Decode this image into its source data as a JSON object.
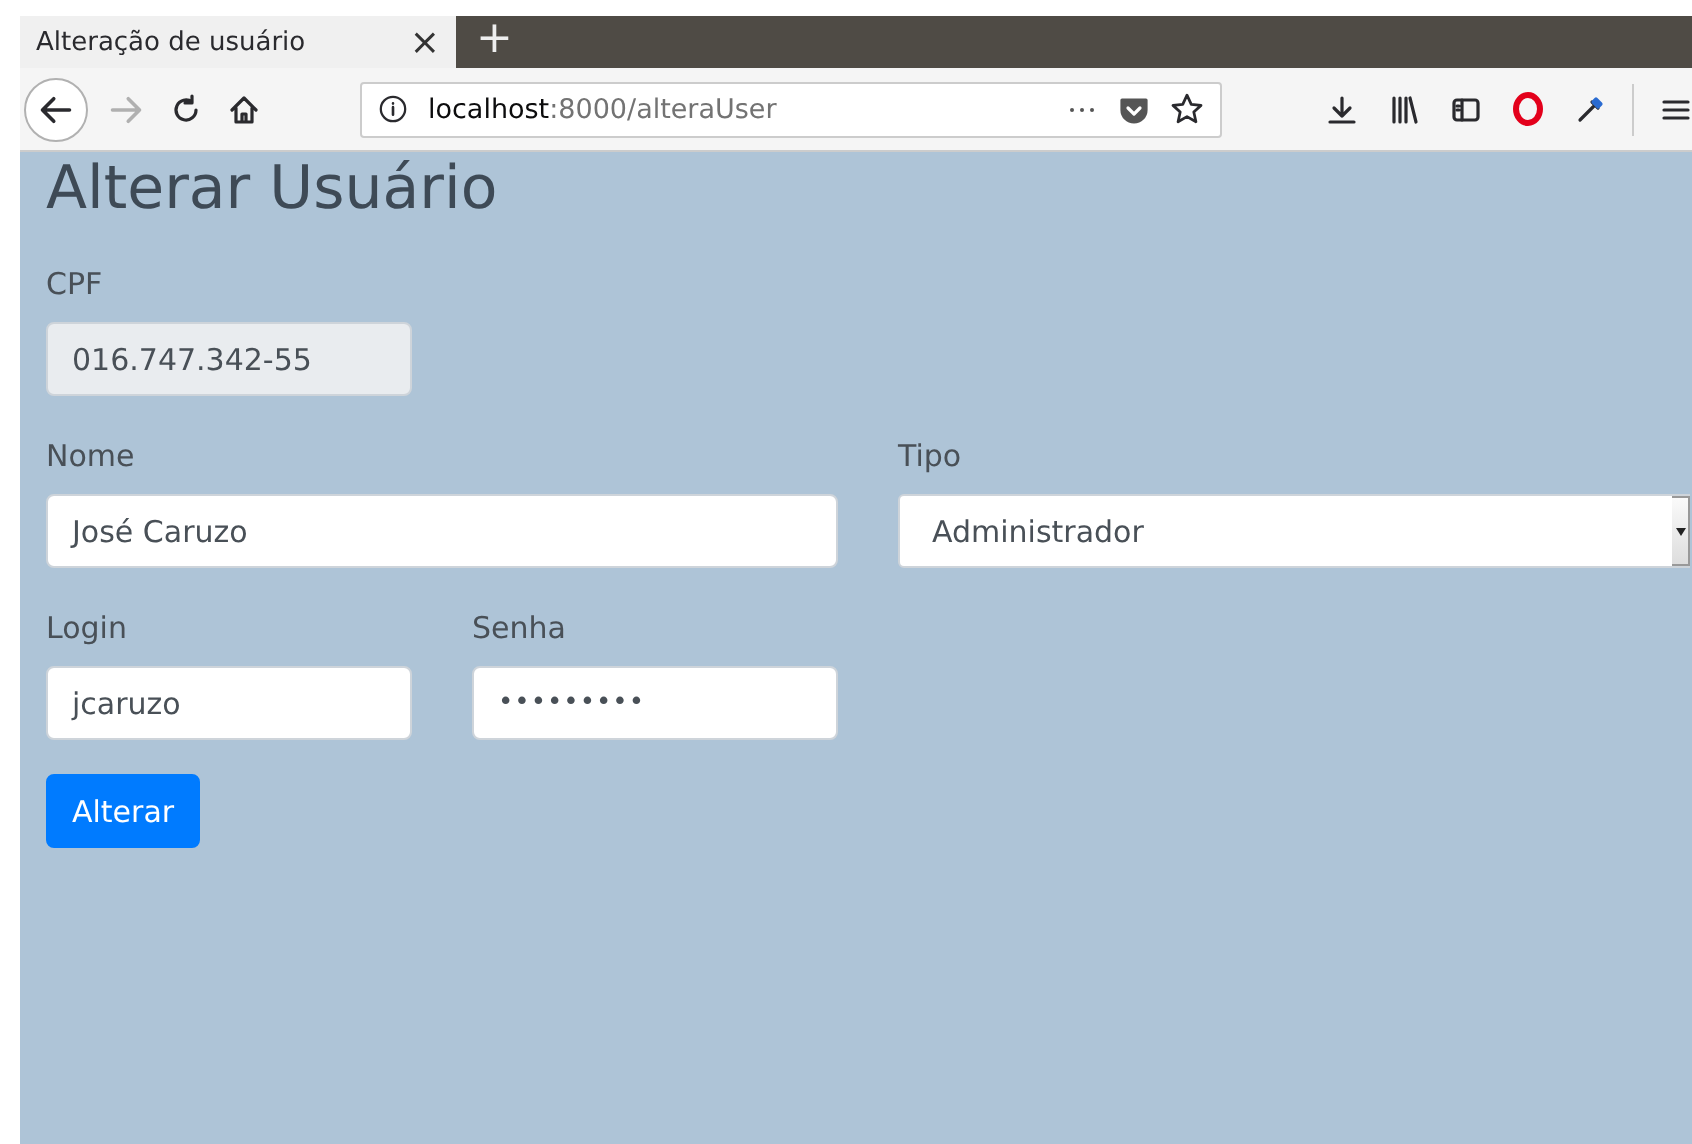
{
  "browser": {
    "tab": {
      "title": "Alteração de usuário",
      "close": "×",
      "selected": true
    },
    "new_tab": "+",
    "address": {
      "host": "localhost",
      "path": ":8000/alteraUser"
    }
  },
  "page": {
    "heading": "Alterar Usuário",
    "rows": [
      [
        {
          "label": "CPF",
          "value": "016.747.342-55",
          "kind": "text",
          "disabled": true
        }
      ],
      [
        {
          "label": "Nome",
          "value": "José Caruzo",
          "kind": "text",
          "disabled": false
        },
        {
          "label": "Tipo",
          "value": "Administrador",
          "kind": "select",
          "disabled": false
        }
      ],
      [
        {
          "label": "Login",
          "value": "jcaruzo",
          "kind": "text",
          "disabled": false
        },
        {
          "label": "Senha",
          "value": "•••••••••",
          "kind": "password",
          "disabled": false
        }
      ]
    ],
    "button": "Alterar"
  }
}
